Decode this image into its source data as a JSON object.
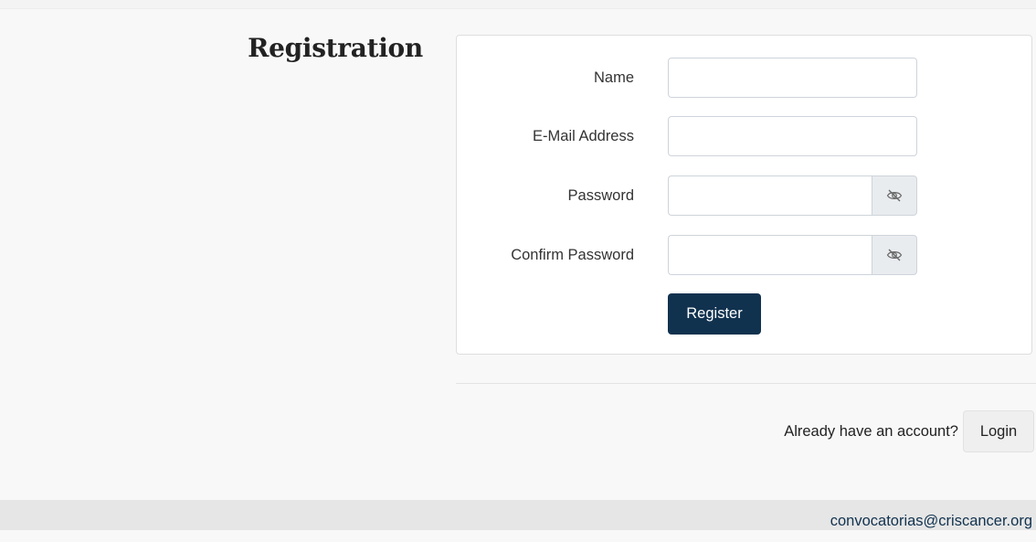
{
  "page": {
    "title": "Registration"
  },
  "form": {
    "name": {
      "label": "Name",
      "value": "",
      "placeholder": ""
    },
    "email": {
      "label": "E-Mail Address",
      "value": "",
      "placeholder": ""
    },
    "password": {
      "label": "Password",
      "value": "",
      "placeholder": "",
      "toggle_icon": "eye-slash-icon"
    },
    "confirm_password": {
      "label": "Confirm Password",
      "value": "",
      "placeholder": "",
      "toggle_icon": "eye-slash-icon"
    },
    "submit_label": "Register"
  },
  "login_prompt": {
    "text": "Already have an account?",
    "button_label": "Login"
  },
  "footer": {
    "email": "convocatorias@criscancer.org"
  },
  "colors": {
    "primary": "#11324f",
    "background": "#f8f8f8",
    "card": "#ffffff",
    "footer": "#e6e6e6"
  }
}
